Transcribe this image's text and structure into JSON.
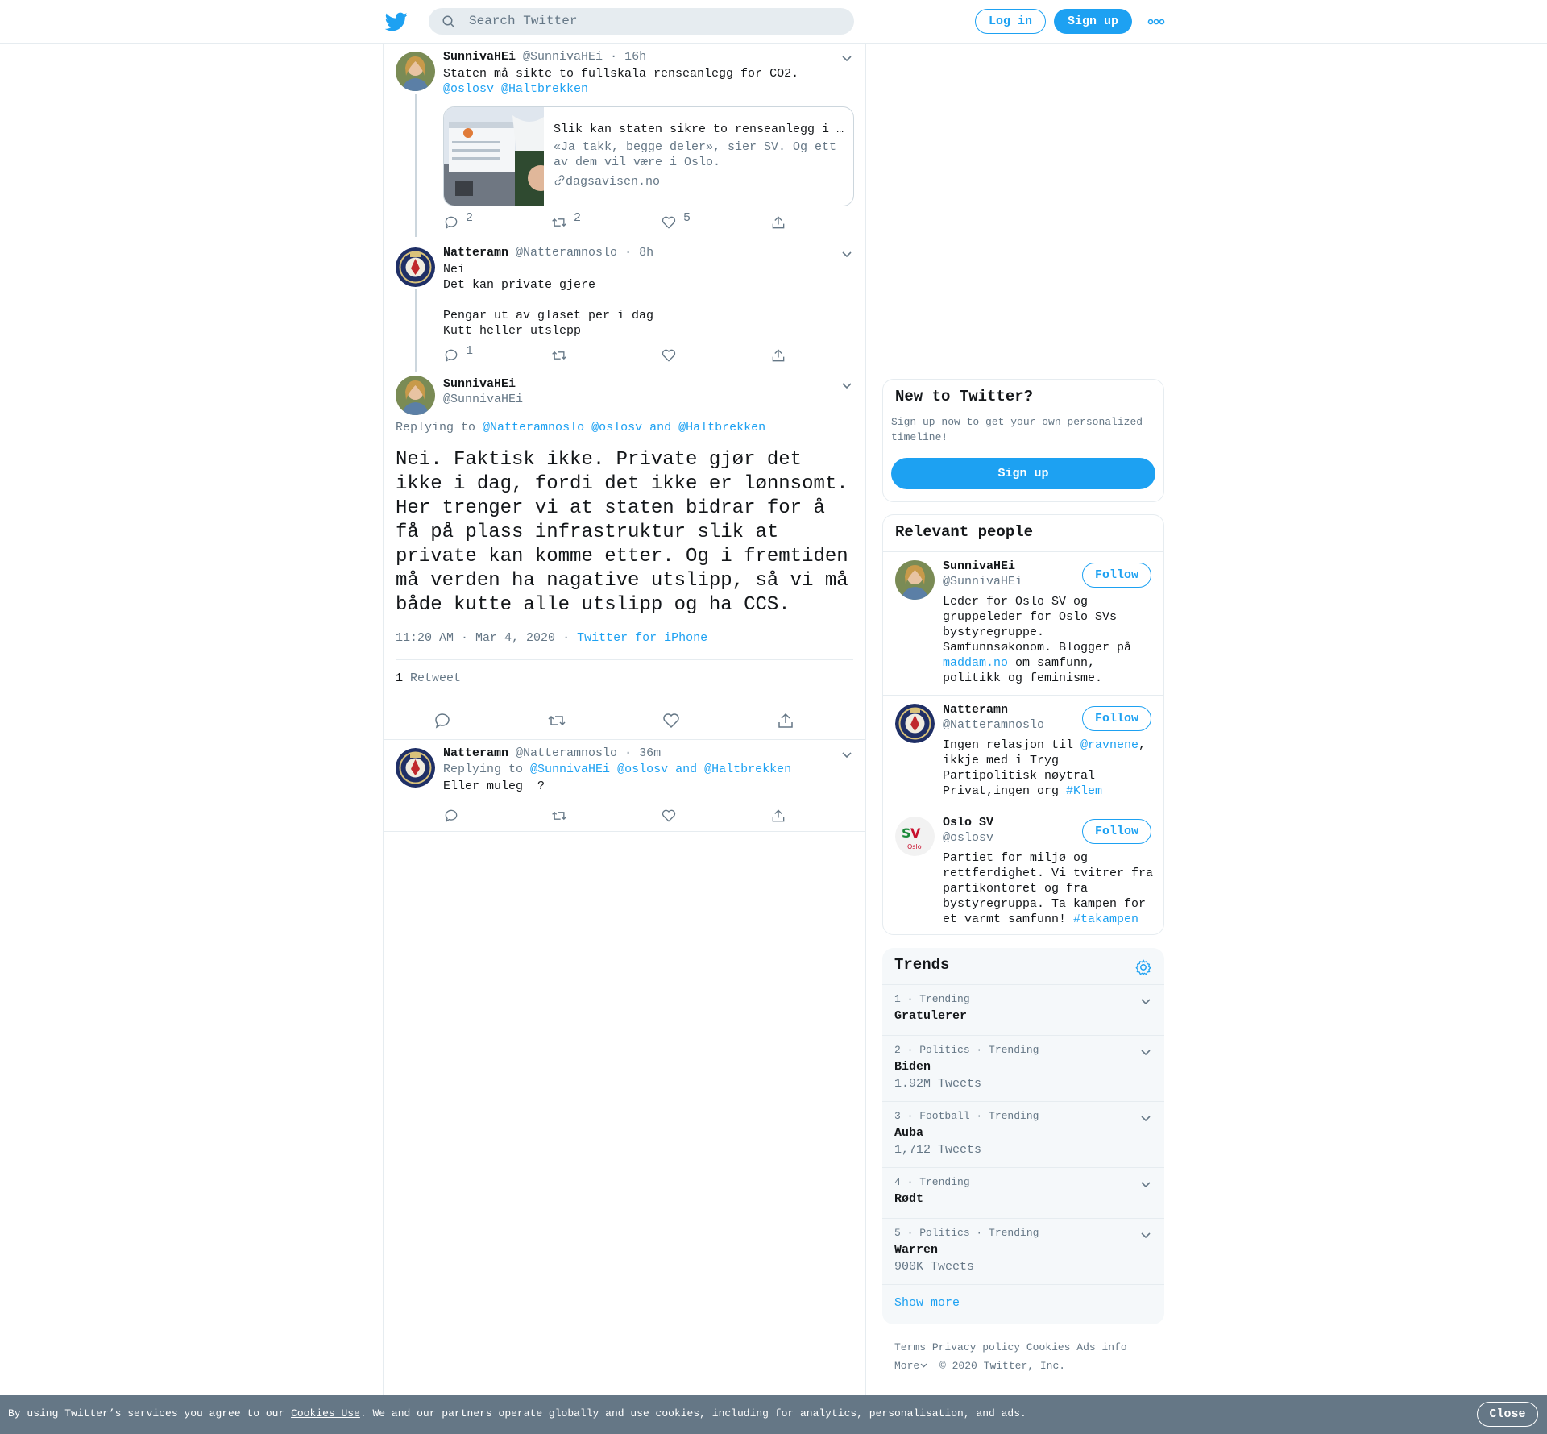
{
  "header": {
    "search_placeholder": "Search Twitter",
    "login_label": "Log in",
    "signup_label": "Sign up"
  },
  "tweets": [
    {
      "name": "SunnivaHEi",
      "handle": "@SunnivaHEi",
      "time": "· 16h",
      "text": "Staten må sikte to fullskala renseanlegg for CO2.",
      "mentions": "@oslosv @Haltbrekken",
      "card": {
        "title": "Slik kan staten sikre to renseanlegg i Oslo",
        "desc": "«Ja takk, begge deler», sier SV. Og ett av dem vil være i Oslo.",
        "domain": "dagsavisen.no"
      },
      "replies": "2",
      "retweets": "2",
      "likes": "5"
    },
    {
      "name": "Natteramn",
      "handle": "@Natteramnoslo",
      "time": "· 8h",
      "text": "Nei\nDet kan private gjere\n\nPengar ut av glaset per i dag\nKutt heller utslepp",
      "replies": "1"
    }
  ],
  "focus": {
    "name": "SunnivaHEi",
    "handle": "@SunnivaHEi",
    "replying_prefix": "Replying to",
    "replying_to": "@Natteramnoslo @oslosv and @Haltbrekken",
    "text": "Nei. Faktisk ikke. Private gjør det ikke i dag, fordi det ikke er lønnsomt. Her trenger vi at staten bidrar for å få på plass infrastruktur slik at private kan komme etter. Og i fremtiden må verden ha nagative utslipp, så vi må både kutte alle utslipp og ha CCS.",
    "timestamp": "11:20 AM · Mar 4, 2020",
    "source": "Twitter for iPhone",
    "retweet_count": "1",
    "retweet_label": "Retweet"
  },
  "reply": {
    "name": "Natteramn",
    "handle": "@Natteramnoslo",
    "time": "· 36m",
    "replying_prefix": "Replying to",
    "replying_to": "@SunnivaHEi @oslosv and @Haltbrekken",
    "text": "Eller muleg  ?"
  },
  "new_to_twitter": {
    "title": "New to Twitter?",
    "subtitle": "Sign up now to get your own personalized timeline!",
    "button": "Sign up"
  },
  "relevant": {
    "title": "Relevant people",
    "follow_label": "Follow",
    "people": [
      {
        "name": "SunnivaHEi",
        "handle": "@SunnivaHEi",
        "bio_a": "Leder for Oslo SV og gruppeleder for Oslo SVs bystyregruppe. Samfunnsøkonom. Blogger på ",
        "bio_link": "maddam.no",
        "bio_b": " om samfunn, politikk og feminisme."
      },
      {
        "name": "Natteramn",
        "handle": "@Natteramnoslo",
        "bio_a": "Ingen relasjon til ",
        "bio_link": "@ravnene",
        "bio_b": ", ikkje med i Tryg Partipolitisk nøytral Privat,ingen org ",
        "bio_link2": "#Klem"
      },
      {
        "name": "Oslo SV",
        "handle": "@oslosv",
        "bio_a": "Partiet for miljø og rettferdighet. Vi tvitrer fra partikontoret og fra bystyregruppa. Ta kampen for et varmt samfunn! ",
        "bio_link": "#takampen"
      }
    ]
  },
  "trends": {
    "title": "Trends",
    "items": [
      {
        "meta": "1 · Trending",
        "name": "Gratulerer",
        "count": ""
      },
      {
        "meta": "2 · Politics · Trending",
        "name": "Biden",
        "count": "1.92M Tweets"
      },
      {
        "meta": "3 · Football · Trending",
        "name": "Auba",
        "count": "1,712 Tweets"
      },
      {
        "meta": "4 · Trending",
        "name": "Rødt",
        "count": ""
      },
      {
        "meta": "5 · Politics · Trending",
        "name": "Warren",
        "count": "900K Tweets"
      }
    ],
    "show_more": "Show more"
  },
  "footer": {
    "terms": "Terms",
    "privacy": "Privacy policy",
    "cookies": "Cookies",
    "ads": "Ads info",
    "more": "More",
    "copyright": "© 2020 Twitter, Inc."
  },
  "cookie_bar": {
    "text_a": "By using Twitter’s services you agree to our ",
    "link": "Cookies Use",
    "text_b": ". We and our partners operate globally and use cookies, including for analytics, personalisation, and ads.",
    "close": "Close"
  },
  "colors": {
    "accent": "#1da1f2",
    "secondary_text": "#657786",
    "border": "#e6ecf0"
  }
}
